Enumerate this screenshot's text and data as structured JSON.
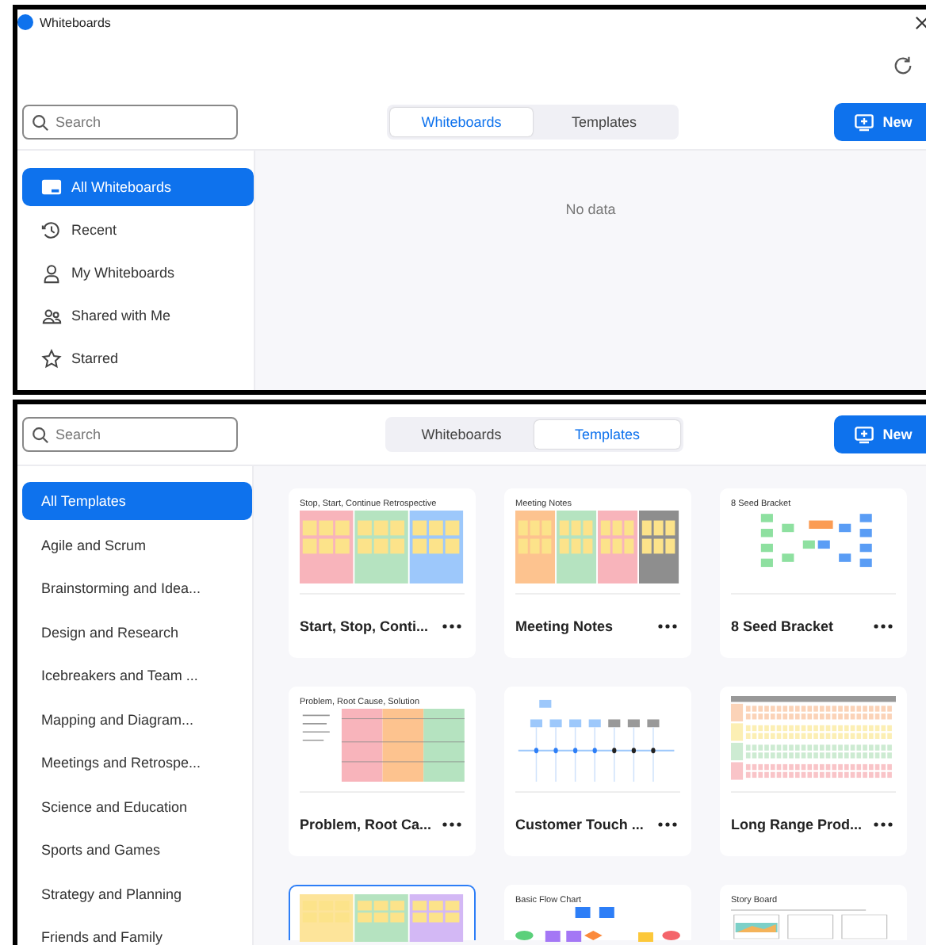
{
  "whiteboards_window": {
    "title": "Whiteboards",
    "search": {
      "placeholder": "Search"
    },
    "tabs": [
      {
        "label": "Whiteboards",
        "selected": true
      },
      {
        "label": "Templates",
        "selected": false
      }
    ],
    "new_button": "New",
    "sidebar": [
      {
        "label": "All Whiteboards",
        "selected": true
      },
      {
        "label": "Recent",
        "selected": false
      },
      {
        "label": "My Whiteboards",
        "selected": false
      },
      {
        "label": "Shared with Me",
        "selected": false
      },
      {
        "label": "Starred",
        "selected": false
      }
    ],
    "empty_message": "No data"
  },
  "templates_window": {
    "search": {
      "placeholder": "Search"
    },
    "tabs": [
      {
        "label": "Whiteboards",
        "selected": false
      },
      {
        "label": "Templates",
        "selected": true
      }
    ],
    "new_button": "New",
    "sidebar": [
      {
        "label": "All Templates",
        "selected": true
      },
      {
        "label": "Agile and Scrum",
        "selected": false
      },
      {
        "label": "Brainstorming and Idea...",
        "selected": false
      },
      {
        "label": "Design and Research",
        "selected": false
      },
      {
        "label": "Icebreakers and Team ...",
        "selected": false
      },
      {
        "label": "Mapping and Diagram...",
        "selected": false
      },
      {
        "label": "Meetings and Retrospe...",
        "selected": false
      },
      {
        "label": "Science and Education",
        "selected": false
      },
      {
        "label": "Sports and Games",
        "selected": false
      },
      {
        "label": "Strategy and Planning",
        "selected": false
      },
      {
        "label": "Friends and Family",
        "selected": false
      }
    ],
    "cards": [
      {
        "title": "Start, Stop, Conti...",
        "selected": false,
        "preview": {
          "kind": "columns",
          "heading": "Stop, Start, Continue Retrospective"
        }
      },
      {
        "title": "Meeting Notes",
        "selected": false,
        "preview": {
          "kind": "columns",
          "heading": "Meeting Notes"
        }
      },
      {
        "title": "8 Seed Bracket",
        "selected": false,
        "preview": {
          "kind": "bracket",
          "heading": "8 Seed Bracket"
        }
      },
      {
        "title": "Problem, Root Ca...",
        "selected": false,
        "preview": {
          "kind": "table",
          "heading": "Problem, Root Cause, Solution"
        }
      },
      {
        "title": "Customer Touch ...",
        "selected": false,
        "preview": {
          "kind": "timeline"
        }
      },
      {
        "title": "Long Range Prod...",
        "selected": false,
        "preview": {
          "kind": "grid"
        }
      },
      {
        "selected": true,
        "preview": {
          "kind": "columns"
        }
      },
      {
        "selected": false,
        "preview": {
          "kind": "flow",
          "heading": "Basic Flow Chart"
        }
      },
      {
        "selected": false,
        "preview": {
          "kind": "storyboard",
          "heading": "Story Board"
        }
      }
    ]
  }
}
